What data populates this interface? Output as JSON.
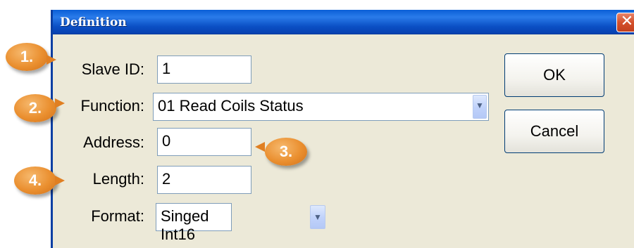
{
  "window": {
    "title": "Definition",
    "close_glyph": "✕"
  },
  "form": {
    "slave_id": {
      "label": "Slave ID:",
      "value": "1"
    },
    "function": {
      "label": "Function:",
      "value": "01 Read Coils Status"
    },
    "address": {
      "label": "Address:",
      "value": "0"
    },
    "length": {
      "label": "Length:",
      "value": "2"
    },
    "format": {
      "label": "Format:",
      "value": "Singed Int16"
    }
  },
  "buttons": {
    "ok": "OK",
    "cancel": "Cancel"
  },
  "callouts": {
    "c1": "1.",
    "c2": "2.",
    "c3": "3.",
    "c4": "4."
  },
  "icons": {
    "dropdown_arrow": "chevron-down-icon",
    "close": "close-icon"
  },
  "colors": {
    "titlebar": "#0a5fd6",
    "dialog_bg": "#ece9d8",
    "close_button": "#d4502c",
    "callout": "#ea8f2f"
  }
}
